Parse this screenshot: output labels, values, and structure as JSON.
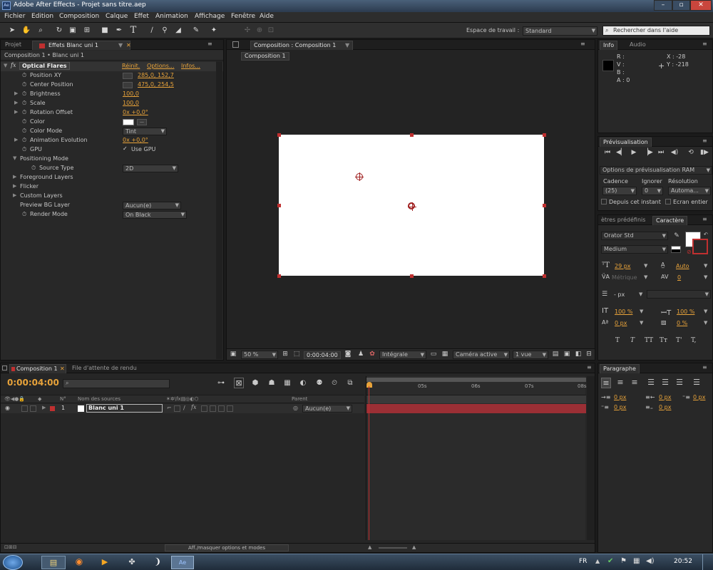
{
  "window": {
    "title": "Adobe After Effects - Projet sans titre.aep",
    "app_icon": "Ae"
  },
  "menu": [
    "Fichier",
    "Edition",
    "Composition",
    "Calque",
    "Effet",
    "Animation",
    "Affichage",
    "Fenêtre",
    "Aide"
  ],
  "toolbar": {
    "workspace_label": "Espace de travail :",
    "workspace_value": "Standard",
    "search_placeholder": "Rechercher dans l'aide"
  },
  "effects_panel": {
    "tabs": [
      "Projet",
      "Effets Blanc uni 1"
    ],
    "breadcrumb": "Composition 1 • Blanc uni 1",
    "effect_name": "Optical Flares",
    "effect_links": [
      "Réinit.",
      "Options...",
      "Infos..."
    ],
    "properties": [
      {
        "label": "Position XY",
        "value": "285,0, 152,7"
      },
      {
        "label": "Center Position",
        "value": "475,0, 254,5"
      },
      {
        "label": "Brightness",
        "value": "100,0"
      },
      {
        "label": "Scale",
        "value": "100,0"
      },
      {
        "label": "Rotation Offset",
        "value": "0x +0,0°"
      },
      {
        "label": "Color",
        "value": ""
      },
      {
        "label": "Color Mode",
        "value": "Tint"
      },
      {
        "label": "Animation Evolution",
        "value": "0x +0,0°"
      },
      {
        "label": "GPU",
        "value": "Use GPU"
      },
      {
        "label": "Positioning Mode",
        "value": ""
      },
      {
        "label": "Source Type",
        "value": "2D"
      },
      {
        "label": "Foreground Layers",
        "value": ""
      },
      {
        "label": "Flicker",
        "value": ""
      },
      {
        "label": "Custom Layers",
        "value": ""
      },
      {
        "label": "Preview BG Layer",
        "value": "Aucun(e)"
      },
      {
        "label": "Render Mode",
        "value": "On Black"
      }
    ]
  },
  "comp_viewer": {
    "tab": "Composition : Composition 1",
    "subtab": "Composition 1",
    "footer": {
      "zoom": "50 %",
      "time": "0:00:04:00",
      "resolution": "Intégrale",
      "camera": "Caméra active",
      "views": "1 vue"
    }
  },
  "info_panel": {
    "tabs": [
      "Info",
      "Audio"
    ],
    "r": "R :",
    "v": "V :",
    "b": "B :",
    "a": "A : 0",
    "x": "X : -28",
    "y": "Y : -218"
  },
  "preview_panel": {
    "tab": "Prévisualisation",
    "ram_options": "Options de prévisualisation RAM",
    "headers": [
      "Cadence",
      "Ignorer",
      "Résolution"
    ],
    "values": [
      "(25)",
      "0",
      "Automa..."
    ],
    "checks": [
      "Depuis cet instant",
      "Ecran entier"
    ]
  },
  "char_panel": {
    "tabs": [
      "ètres prédéfinis",
      "Caractère"
    ],
    "font": "Orator Std",
    "style": "Medium",
    "size": "29 px",
    "leading": "Auto",
    "kerning": "Métrique",
    "tracking": "0",
    "stroke": "- px",
    "vscale": "100 %",
    "hscale": "100 %",
    "baseline": "0 px",
    "tsume": "0 %",
    "styles": [
      "T",
      "T",
      "TT",
      "Tт",
      "T'",
      "T,"
    ]
  },
  "paragraph_panel": {
    "tab": "Paragraphe",
    "indents": [
      "0 px",
      "0 px",
      "0 px",
      "0 px",
      "0 px"
    ]
  },
  "timeline": {
    "tabs": [
      "Composition 1",
      "File d'attente de rendu"
    ],
    "timecode": "0:00:04:00",
    "col_no": "N°",
    "col_source": "Nom des sources",
    "col_parent": "Parent",
    "layer": {
      "num": "1",
      "name": "Blanc uni 1",
      "parent": "Aucun(e)"
    },
    "ruler": [
      "05s",
      "06s",
      "07s",
      "08s"
    ],
    "footer": "Aff./masquer options et modes"
  },
  "taskbar": {
    "lang": "FR",
    "time": "20:52"
  },
  "colors": {
    "accent": "#e8a33a",
    "layer_bar": "#9b2f35",
    "handle": "#c03030"
  }
}
